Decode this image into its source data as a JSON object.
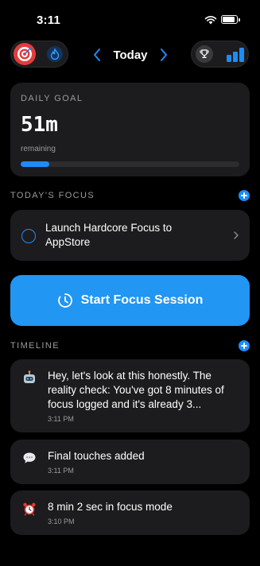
{
  "status_bar": {
    "time": "3:11"
  },
  "header": {
    "date_label": "Today"
  },
  "daily_goal": {
    "label": "DAILY GOAL",
    "value": "51m",
    "sub_label": "remaining",
    "progress_fraction": 0.13
  },
  "todays_focus": {
    "section_title": "TODAY'S FOCUS",
    "task_text": "Launch Hardcore Focus to AppStore"
  },
  "start_button": {
    "label": "Start Focus Session"
  },
  "timeline": {
    "section_title": "TIMELINE",
    "items": [
      {
        "icon": "robot-icon",
        "message": "Hey, let's look at this honestly. The reality check: You've got 8 minutes of focus logged and it's already 3...",
        "time": "3:11 PM"
      },
      {
        "icon": "speech-bubble-icon",
        "message": "Final touches added",
        "time": "3:11 PM"
      },
      {
        "icon": "alarm-clock-icon",
        "message": "8 min 2 sec in focus mode",
        "time": "3:10 PM"
      }
    ]
  },
  "colors": {
    "accent": "#1d8cf8",
    "card": "#1c1c1e",
    "background": "#000000",
    "button": "#2196f3"
  }
}
